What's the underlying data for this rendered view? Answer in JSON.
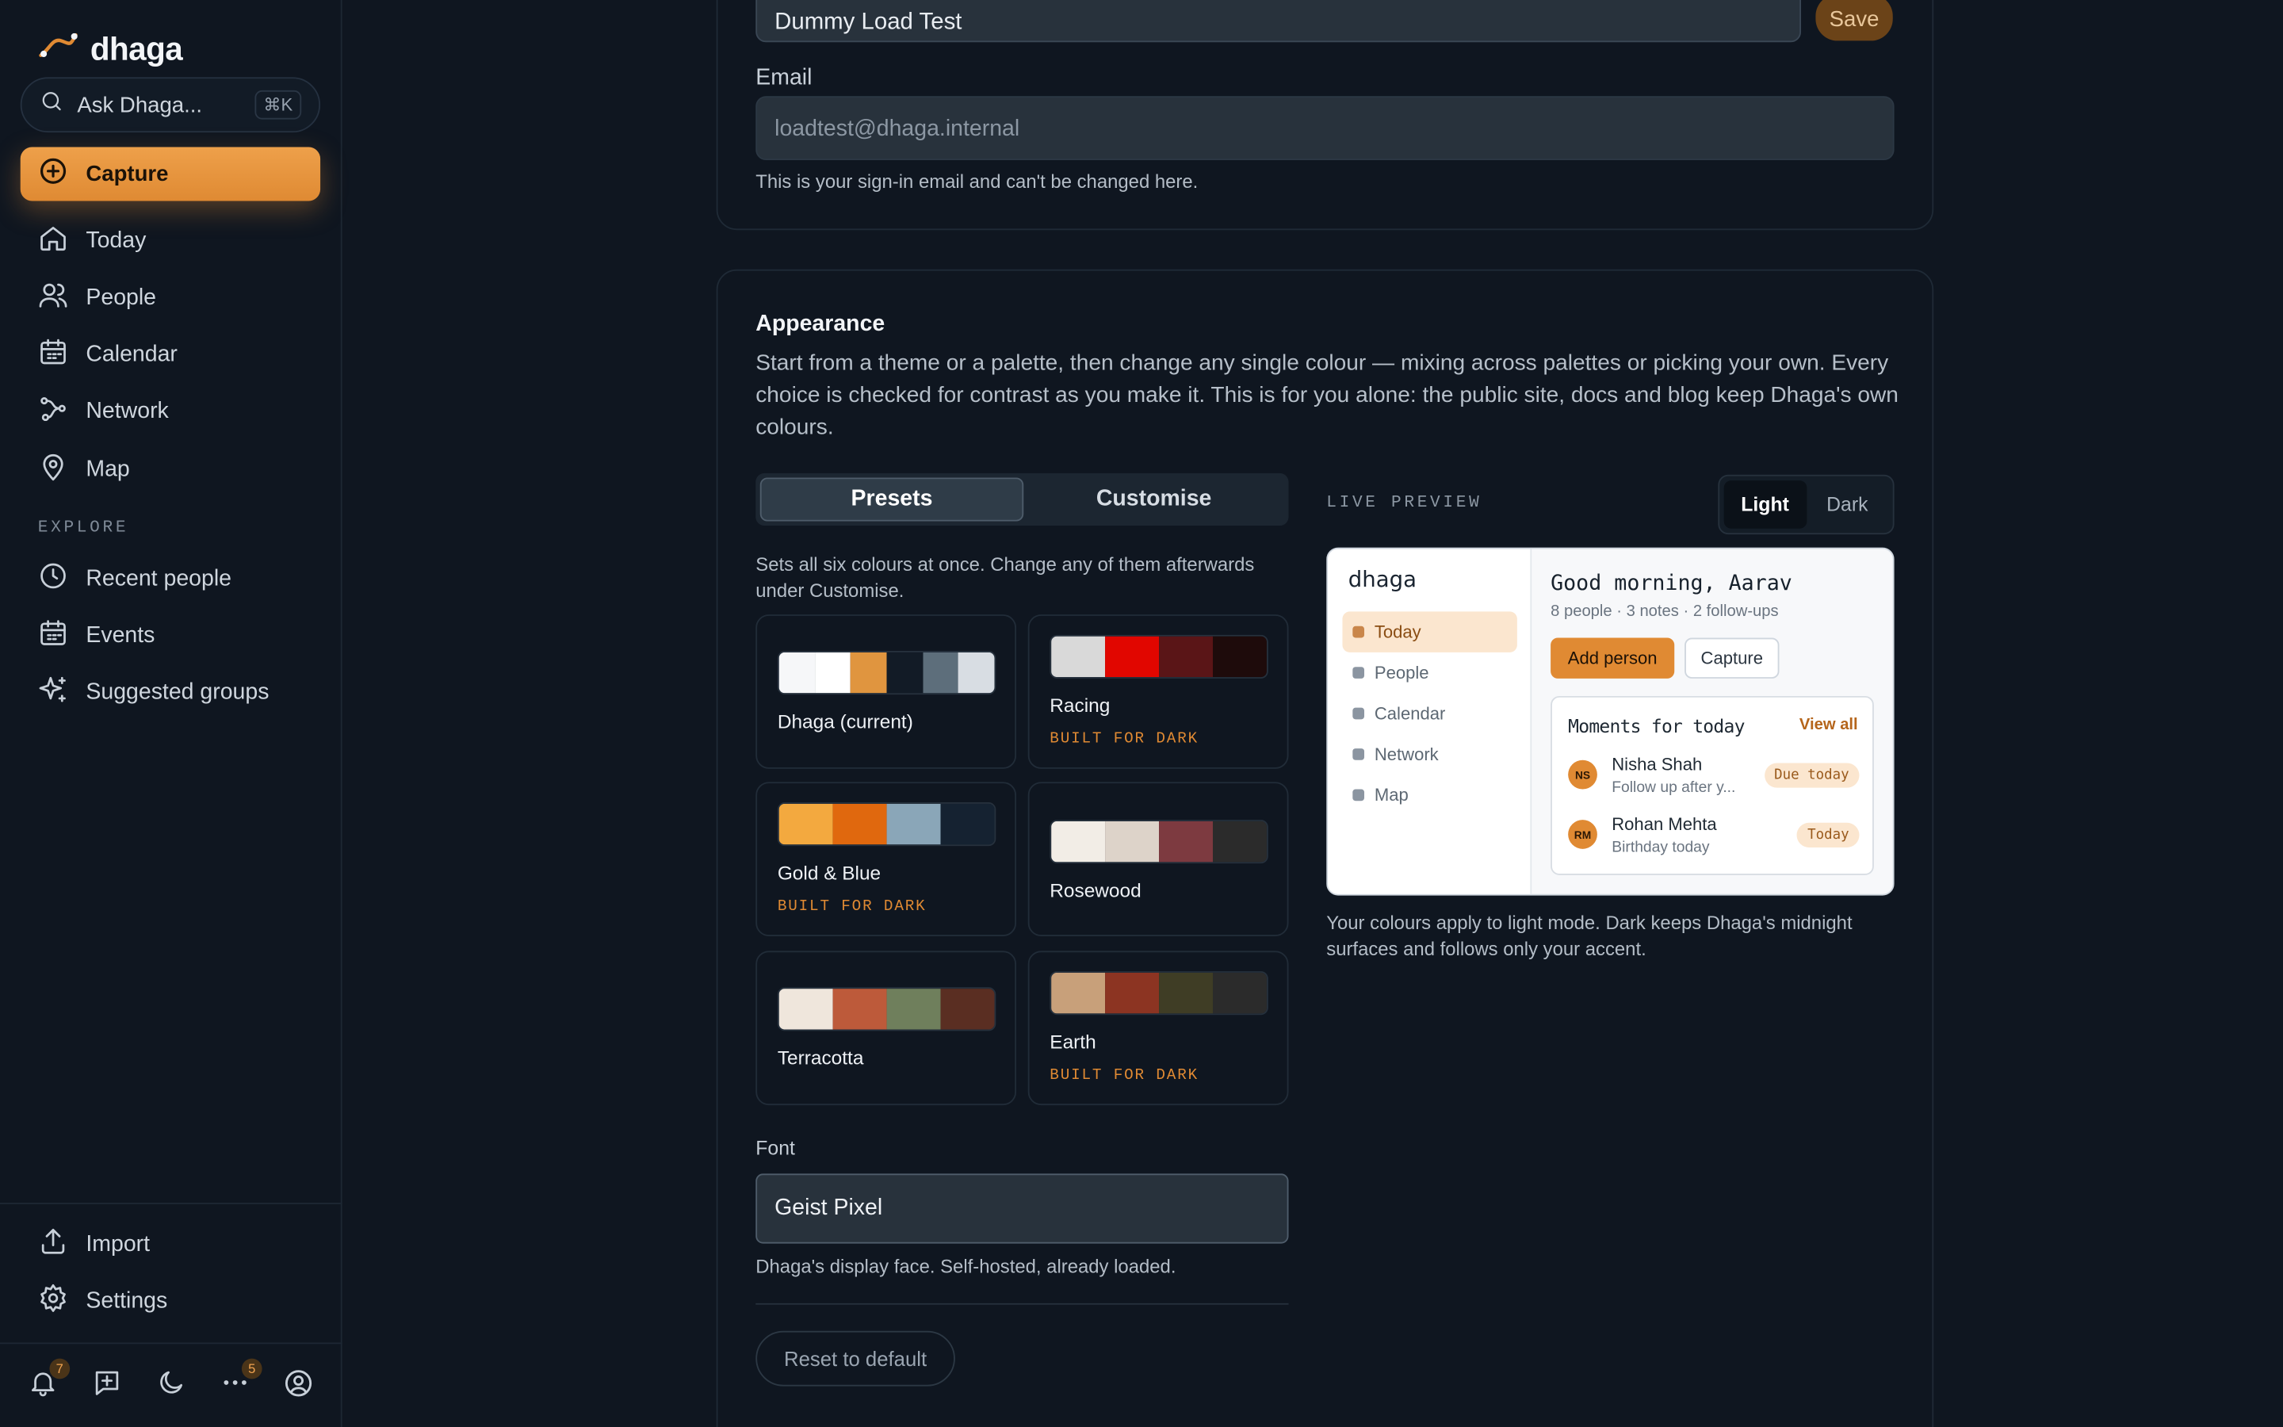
{
  "sidebar": {
    "brand": "dhaga",
    "search_placeholder": "Ask Dhaga...",
    "search_shortcut": "⌘K",
    "capture_label": "Capture",
    "nav": [
      {
        "label": "Today",
        "icon": "home-icon"
      },
      {
        "label": "People",
        "icon": "people-icon"
      },
      {
        "label": "Calendar",
        "icon": "calendar-icon"
      },
      {
        "label": "Network",
        "icon": "network-icon"
      },
      {
        "label": "Map",
        "icon": "map-pin-icon"
      }
    ],
    "explore_label": "EXPLORE",
    "explore": [
      {
        "label": "Recent people",
        "icon": "clock-icon"
      },
      {
        "label": "Events",
        "icon": "calendar-icon"
      },
      {
        "label": "Suggested groups",
        "icon": "sparkles-icon"
      }
    ],
    "bottom": [
      {
        "label": "Import",
        "icon": "upload-icon"
      },
      {
        "label": "Settings",
        "icon": "gear-icon"
      }
    ],
    "footer": {
      "notifications_count": "7",
      "more_count": "5"
    }
  },
  "profile": {
    "name_value": "Dummy Load Test",
    "save_label": "Save",
    "email_label": "Email",
    "email_value": "loadtest@dhaga.internal",
    "email_help": "This is your sign-in email and can't be changed here."
  },
  "appearance": {
    "title": "Appearance",
    "description": "Start from a theme or a palette, then change any single colour — mixing across palettes or picking your own. Every choice is checked for contrast as you make it. This is for you alone: the public site, docs and blog keep Dhaga's own colours.",
    "tabs": {
      "presets": "Presets",
      "customise": "Customise",
      "active": "presets"
    },
    "presets_help": "Sets all six colours at once. Change any of them afterwards under Customise.",
    "presets": [
      {
        "name": "Dhaga (current)",
        "sub": "",
        "colors": [
          "#f6f7f9",
          "#ffffff",
          "#e0953f",
          "#121b26",
          "#5d6e7b",
          "#d8dde3"
        ]
      },
      {
        "name": "Racing",
        "sub": "BUILT FOR DARK",
        "colors": [
          "#d9d9d9",
          "#e10600",
          "#5a1517",
          "#1e0b0b"
        ]
      },
      {
        "name": "Gold & Blue",
        "sub": "BUILT FOR DARK",
        "colors": [
          "#f3a93f",
          "#e0680e",
          "#8aa6b8",
          "#152231"
        ]
      },
      {
        "name": "Rosewood",
        "sub": "",
        "colors": [
          "#f2ede6",
          "#ddd3c9",
          "#7d3a40",
          "#2b2b2b"
        ]
      },
      {
        "name": "Terracotta",
        "sub": "",
        "colors": [
          "#efe6dc",
          "#bd5a3a",
          "#6f7f5c",
          "#5a2e22"
        ]
      },
      {
        "name": "Earth",
        "sub": "BUILT FOR DARK",
        "colors": [
          "#c8a07a",
          "#8c3422",
          "#3f3d25",
          "#2b2b2b"
        ]
      }
    ],
    "font_label": "Font",
    "font_value": "Geist Pixel",
    "font_help": "Dhaga's display face. Self-hosted, already loaded.",
    "reset_label": "Reset to default",
    "live_preview": {
      "label": "LIVE PREVIEW",
      "modes": {
        "light": "Light",
        "dark": "Dark",
        "active": "light"
      },
      "brand": "dhaga",
      "nav": [
        "Today",
        "People",
        "Calendar",
        "Network",
        "Map"
      ],
      "greeting": "Good morning, Aarav",
      "stats": "8 people · 3 notes · 2 follow-ups",
      "add_person": "Add person",
      "capture": "Capture",
      "moments_title": "Moments for today",
      "view_all": "View all",
      "moments": [
        {
          "initials": "NS",
          "name": "Nisha Shah",
          "note": "Follow up after y...",
          "tag": "Due today"
        },
        {
          "initials": "RM",
          "name": "Rohan Mehta",
          "note": "Birthday today",
          "tag": "Today"
        }
      ],
      "help": "Your colours apply to light mode. Dark keeps Dhaga's midnight surfaces and follows only your accent."
    }
  },
  "colors": {
    "accent": "#e08a33",
    "background": "#0f1620",
    "surface": "#28323c"
  }
}
